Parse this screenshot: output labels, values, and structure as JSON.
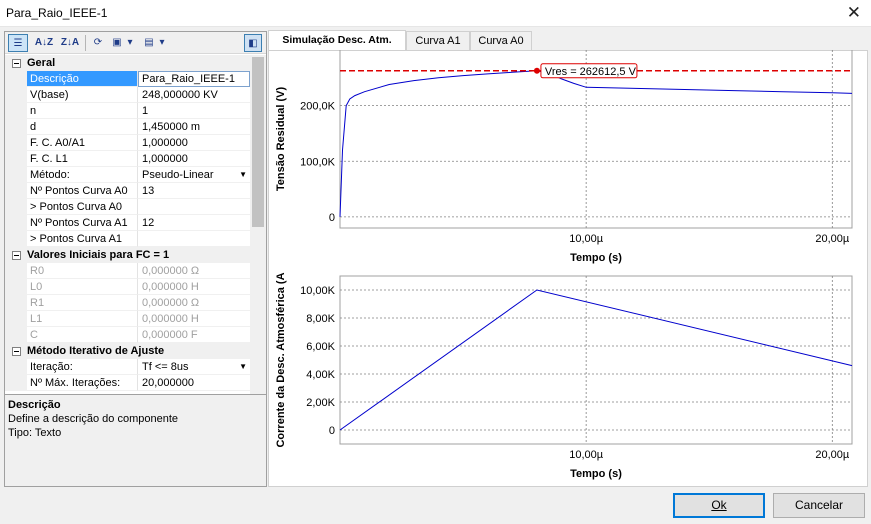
{
  "window": {
    "title": "Para_Raio_IEEE-1"
  },
  "toolbar": {
    "sort_alpha_asc": "A↓Z",
    "sort_alpha_desc": "Z↓A",
    "dropdown_arrow": "▾"
  },
  "properties": {
    "cat_geral": "Geral",
    "descricao": {
      "name": "Descrição",
      "value": "Para_Raio_IEEE-1"
    },
    "vbase": {
      "name": "V(base)",
      "value": "248,000000 KV"
    },
    "n": {
      "name": "n",
      "value": "1"
    },
    "d": {
      "name": "d",
      "value": "1,450000 m"
    },
    "fc_a0a1": {
      "name": "F. C. A0/A1",
      "value": "1,000000"
    },
    "fc_l1": {
      "name": "F. C. L1",
      "value": "1,000000"
    },
    "metodo": {
      "name": "Método:",
      "value": "Pseudo-Linear"
    },
    "np_a0": {
      "name": "Nº Pontos Curva A0",
      "value": "13"
    },
    "p_a0": {
      "name": "> Pontos Curva A0",
      "value": ""
    },
    "np_a1": {
      "name": "Nº Pontos Curva A1",
      "value": "12"
    },
    "p_a1": {
      "name": "> Pontos Curva A1",
      "value": ""
    },
    "cat_vi": "Valores Iniciais para FC = 1",
    "r0": {
      "name": "R0",
      "value": "0,000000 Ω"
    },
    "l0": {
      "name": "L0",
      "value": "0,000000 H"
    },
    "r1": {
      "name": "R1",
      "value": "0,000000 Ω"
    },
    "l1": {
      "name": "L1",
      "value": "0,000000 H"
    },
    "c": {
      "name": "C",
      "value": "0,000000 F"
    },
    "cat_mi": "Método Iterativo de Ajuste",
    "iteracao": {
      "name": "Iteração:",
      "value": "Tf <= 8us"
    },
    "maxit": {
      "name": "Nº Máx. Iterações:",
      "value": "20,000000"
    }
  },
  "description": {
    "title": "Descrição",
    "text": "Define a descrição do componente",
    "type": "Tipo: Texto"
  },
  "tabs": [
    "Simulação Desc. Atm.",
    "Curva A1",
    "Curva A0"
  ],
  "colors": {
    "series": "#0000cc",
    "marker": "#dd0000",
    "grid": "#808080"
  },
  "chart_data": [
    {
      "type": "line",
      "ylabel": "Tensão Residual (V)",
      "xlabel": "Tempo (s)",
      "xlim": [
        0,
        2.08e-05
      ],
      "ylim": [
        -20000,
        300000
      ],
      "xticks": [
        {
          "v": 1e-05,
          "label": "10,00µ"
        },
        {
          "v": 2e-05,
          "label": "20,00µ"
        }
      ],
      "yticks": [
        {
          "v": 0,
          "label": "0"
        },
        {
          "v": 100000,
          "label": "100,0K"
        },
        {
          "v": 200000,
          "label": "200,0K"
        }
      ],
      "series": [
        {
          "x": [
            0,
            1e-07,
            2.5e-07,
            4e-07,
            6e-07,
            1e-06,
            2e-06,
            3e-06,
            4e-06,
            5e-06,
            6e-06,
            7e-06,
            8e-06,
            8.5e-06,
            9e-06,
            9.5e-06,
            1e-05,
            1.2e-05,
            1.4e-05,
            1.6e-05,
            1.8e-05,
            2e-05,
            2.08e-05
          ],
          "y": [
            0,
            120000,
            200000,
            212000,
            218000,
            225000,
            238000,
            245000,
            250000,
            254000,
            257000,
            260000,
            262612,
            258000,
            248000,
            240000,
            233000,
            231000,
            229000,
            227000,
            225000,
            223000,
            222000
          ]
        }
      ],
      "marker": {
        "x": 8e-06,
        "y": 262612.5,
        "label": "Vres = 262612,5 V"
      }
    },
    {
      "type": "line",
      "ylabel": "Corrente da Desc. Atmosférica (A",
      "xlabel": "Tempo (s)",
      "xlim": [
        0,
        2.08e-05
      ],
      "ylim": [
        -1000,
        11000
      ],
      "xticks": [
        {
          "v": 1e-05,
          "label": "10,00µ"
        },
        {
          "v": 2e-05,
          "label": "20,00µ"
        }
      ],
      "yticks": [
        {
          "v": 0,
          "label": "0"
        },
        {
          "v": 2000,
          "label": "2,00K"
        },
        {
          "v": 4000,
          "label": "4,00K"
        },
        {
          "v": 6000,
          "label": "6,00K"
        },
        {
          "v": 8000,
          "label": "8,00K"
        },
        {
          "v": 10000,
          "label": "10,00K"
        }
      ],
      "series": [
        {
          "x": [
            0,
            8e-06,
            2.08e-05
          ],
          "y": [
            0,
            10000,
            4600
          ]
        }
      ]
    }
  ],
  "buttons": {
    "ok": "Ok",
    "cancel": "Cancelar"
  }
}
